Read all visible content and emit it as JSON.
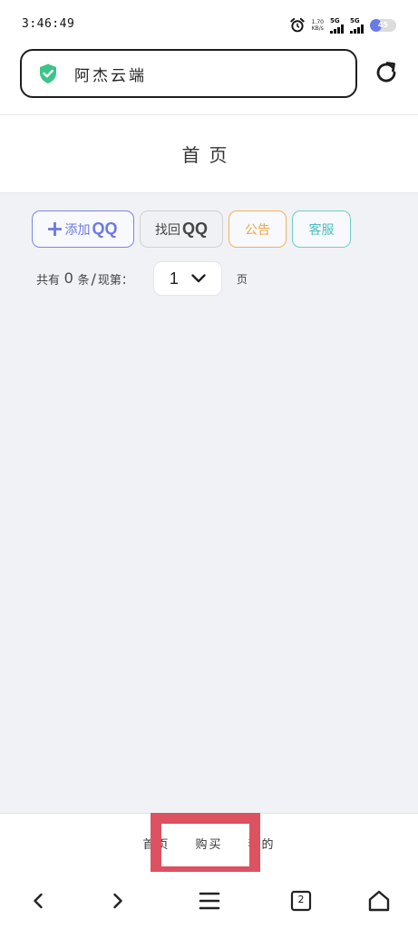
{
  "status_bar": {
    "time": "3:46:49",
    "net_speed_top": "1.70",
    "net_speed_bottom": "KB/s",
    "sim1": "5G",
    "sim2": "5G",
    "battery": "45",
    "battery_level": 0.45,
    "icons": [
      "alarm-icon",
      "signal-icon",
      "battery-icon"
    ]
  },
  "url_bar": {
    "site_name": "阿杰云端",
    "icons": [
      "shield-check-icon",
      "reload-icon"
    ]
  },
  "page": {
    "title": "首页"
  },
  "actions": {
    "add_label": "添加",
    "add_suffix": "QQ",
    "find_label": "找回",
    "find_suffix": "QQ",
    "notice_label": "公告",
    "service_label": "客服"
  },
  "pager": {
    "prefix": "共有",
    "count": "0",
    "mid": "条",
    "slash": "/",
    "current_label": "现第：",
    "page_value": "1",
    "unit": "页"
  },
  "site_tabs": {
    "home": "首页",
    "buy": "购买",
    "mine": "我的"
  },
  "browser_nav": {
    "tab_count": "2"
  },
  "colors": {
    "add": "#6b79e3",
    "notice": "#f0a644",
    "service": "#4dbfbc",
    "shield": "#3cc48b",
    "highlight": "#dc5260"
  }
}
